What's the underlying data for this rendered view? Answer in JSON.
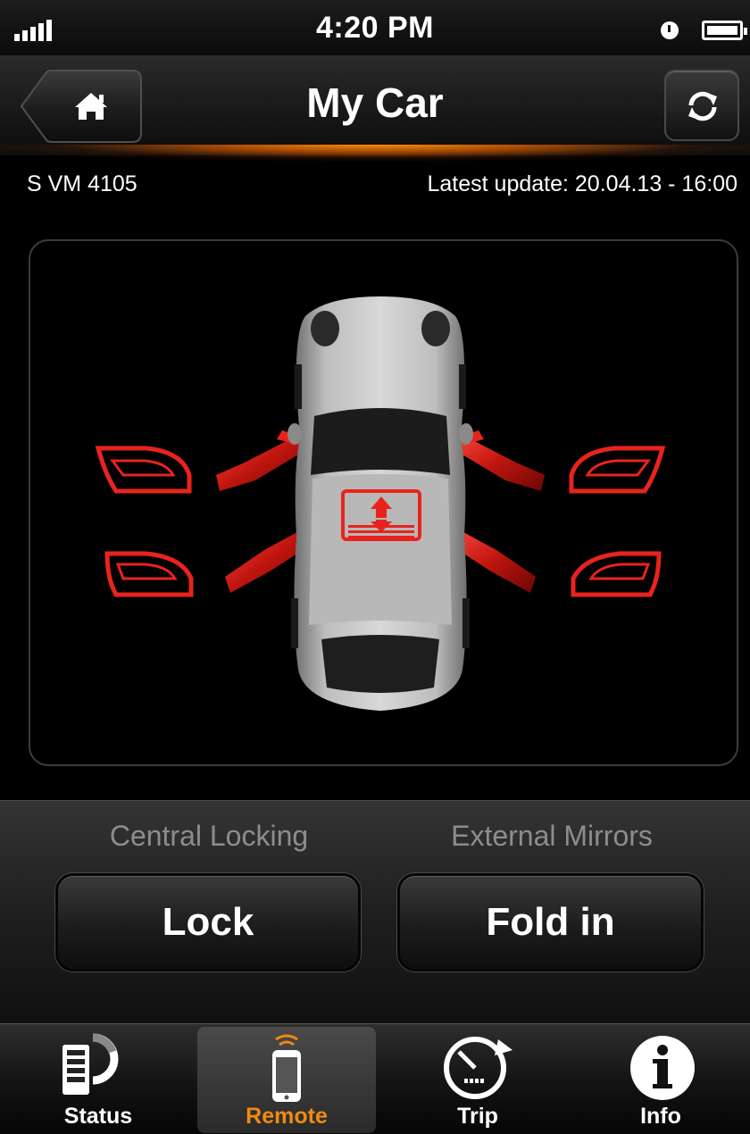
{
  "status_bar": {
    "time": "4:20 PM",
    "signal_icon": "signal-bars-icon",
    "alarm_icon": "clock-icon",
    "battery_icon": "battery-icon"
  },
  "nav": {
    "title": "My Car",
    "home_icon": "home-icon",
    "refresh_icon": "refresh-icon"
  },
  "info": {
    "plate": "S VM 4105",
    "latest_update": "Latest update: 20.04.13 - 16:00"
  },
  "car": {
    "door_highlight_color": "#e8231d",
    "window_icon": "window-up-icon"
  },
  "controls": {
    "central_locking_label": "Central Locking",
    "lock_button": "Lock",
    "external_mirrors_label": "External Mirrors",
    "fold_button": "Fold in"
  },
  "tabs": [
    {
      "label": "Status",
      "icon": "status-gauge-icon",
      "active": false
    },
    {
      "label": "Remote",
      "icon": "remote-phone-icon",
      "active": true
    },
    {
      "label": "Trip",
      "icon": "trip-meter-icon",
      "active": false
    },
    {
      "label": "Info",
      "icon": "info-icon",
      "active": false
    }
  ],
  "colors": {
    "accent": "#f08a12",
    "alert_red": "#e8231d",
    "background": "#000000"
  }
}
